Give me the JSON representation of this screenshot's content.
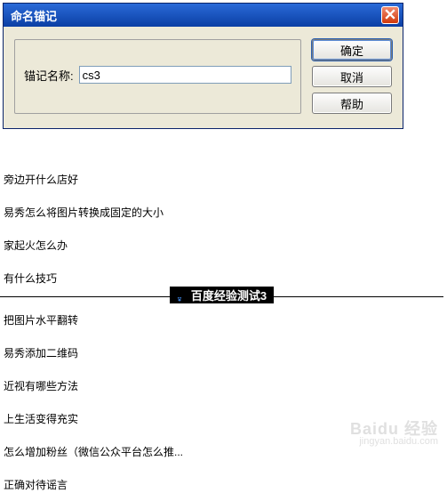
{
  "dialog": {
    "title": "命名锚记",
    "field_label": "锚记名称:",
    "field_value": "cs3",
    "buttons": {
      "ok": "确定",
      "cancel": "取消",
      "help": "帮助"
    }
  },
  "list": {
    "items": [
      "旁边开什么店好",
      "易秀怎么将图片转换成固定的大小",
      "家起火怎么办",
      "有什么技巧",
      "把图片水平翻转",
      "易秀添加二维码",
      "近视有哪些方法",
      "上生活变得充实",
      "怎么增加粉丝（微信公众平台怎么推...",
      "正确对待谣言"
    ]
  },
  "watermark": {
    "center": "百度经验测试3",
    "corner_brand": "Baidu 经验",
    "corner_url": "jingyan.baidu.com"
  }
}
